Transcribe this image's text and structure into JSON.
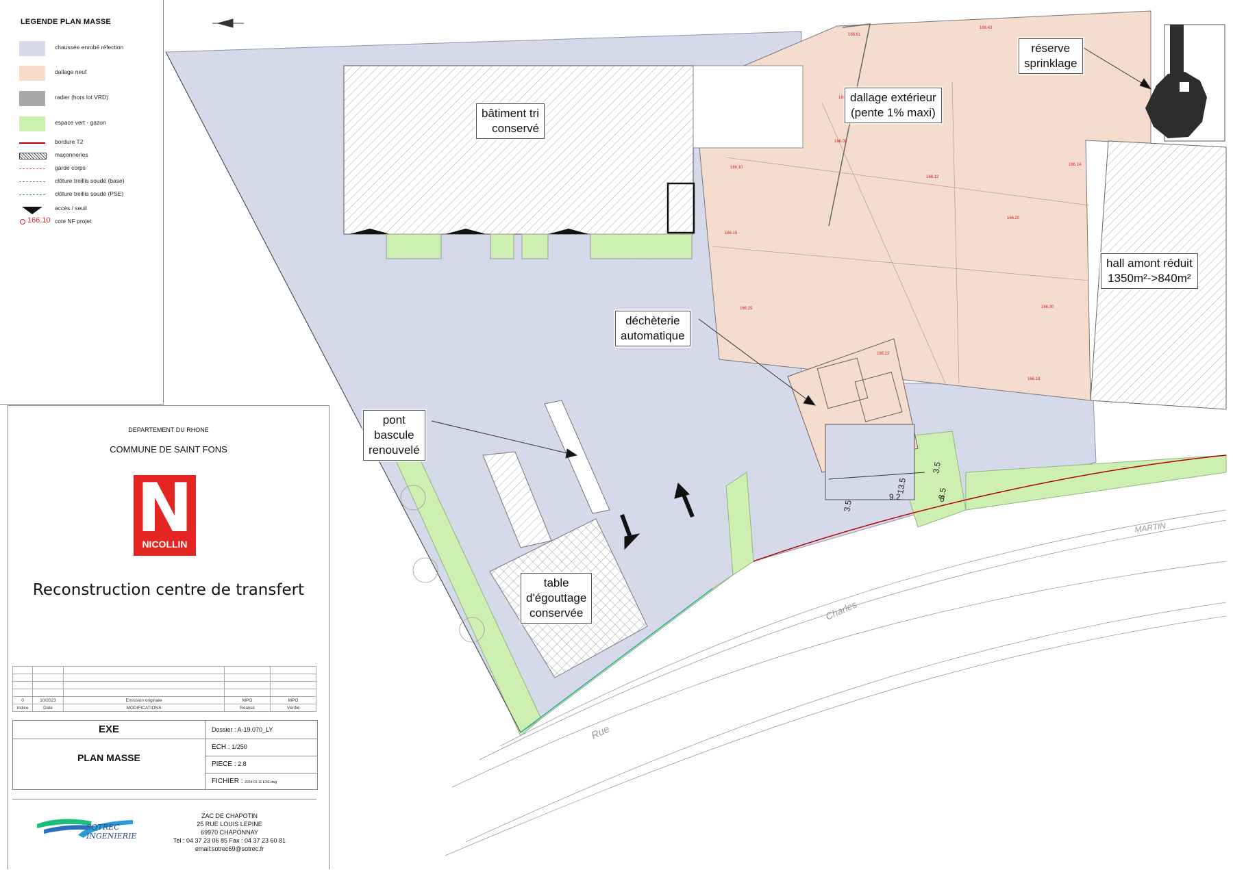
{
  "legend": {
    "title": "LEGENDE PLAN MASSE",
    "items": [
      {
        "label": "chaussée enrobé réfection",
        "swatch": "#d5d9ea",
        "kind": "fill"
      },
      {
        "label": "dallage neuf",
        "swatch": "#f8dcc9",
        "kind": "fill"
      },
      {
        "label": "radier (hors lot VRD)",
        "swatch": "#a9a9a9",
        "kind": "fill"
      },
      {
        "label": "espace vert - gazon",
        "swatch": "#cdefb2",
        "kind": "fill"
      },
      {
        "label": "bordure T2",
        "swatch": "#b00000",
        "kind": "line"
      },
      {
        "label": "maçonneries",
        "swatch": "#444444",
        "kind": "hatch"
      },
      {
        "label": "garde corps",
        "swatch": "#e05ab0",
        "kind": "dashline"
      },
      {
        "label": "clôture treillis soudé (base)",
        "swatch": "#6a7aa8",
        "kind": "dashline"
      },
      {
        "label": "clôture treillis soudé (PSE)",
        "swatch": "#2aa8a0",
        "kind": "dashline"
      },
      {
        "label": "accès / seuil",
        "swatch": "#111111",
        "kind": "arrow"
      },
      {
        "label": "cote NF projet",
        "value": "166.10",
        "swatch": "#d22222",
        "kind": "level"
      }
    ]
  },
  "cartouche": {
    "department": "DEPARTEMENT DU RHONE",
    "commune": "COMMUNE DE SAINT FONS",
    "logo_letter": "N",
    "logo_text": "NICOLLIN",
    "logo_color": "#e42521",
    "project_title": "Reconstruction centre de transfert",
    "revision_row": {
      "indice": "0",
      "date": "10/2023",
      "modification": "Emission originale",
      "realise": "MPO",
      "verifie": "MPO"
    },
    "revision_headers": {
      "indice": "Indice",
      "date": "Date",
      "modification": "MODIFICATIONS",
      "realise": "Réalisé",
      "verifie": "Vérifié"
    },
    "phase": "EXE",
    "drawing_title": "PLAN MASSE",
    "dossier_label": "Dossier :",
    "dossier_value": "A-19.070_LY",
    "echelle_label": "ECH :",
    "echelle_value": "1/250",
    "piece_label": "PIECE :",
    "piece_value": "2.8",
    "fichier_label": "FICHIER :",
    "fichier_value": "2024-01-11 EXE.dwg",
    "company_name_1": "SOTREC",
    "company_name_2": "INGENIERIE",
    "address_lines": [
      "ZAC DE CHAPOTIN",
      "25 RUE LOUIS LEPINE",
      "69970 CHAPONNAY",
      "Tel : 04 37 23 06 85 Fax : 04 37 23 60 81",
      "email:sotrec69@sotrec.fr"
    ]
  },
  "plan_labels": {
    "batiment": [
      "bâtiment tri",
      "conservé"
    ],
    "dallage": [
      "dallage extérieur",
      "(pente  1% maxi)"
    ],
    "sprinklage": [
      "réserve",
      "sprinklage"
    ],
    "hall": [
      "hall amont réduit",
      " 1350m²->840m²"
    ],
    "decheterie": [
      "déchèterie",
      "automatique"
    ],
    "pont": [
      "pont",
      "bascule",
      "renouvelé"
    ],
    "table": [
      "table",
      "d'égouttage",
      "conservée"
    ]
  },
  "street": {
    "rue": "Rue",
    "charles": "Charles",
    "martin": "MARTIN"
  },
  "dimensions": [
    "13.5",
    "3.5",
    "9.2",
    "3.5",
    "3.5",
    "6"
  ],
  "levels": [
    "166.61",
    "166.43",
    "166.10",
    "166.14",
    "166.12",
    "166.15",
    "166.20",
    "166.30",
    "166.25",
    "166.22",
    "166.18",
    "166.35",
    "166.05"
  ],
  "colors": {
    "road": "#d5d9ea",
    "slab": "#f4dccf",
    "green": "#cdefb2",
    "hatch": "#9a9a9a",
    "kerb": "#b00000",
    "level": "#d22222"
  }
}
